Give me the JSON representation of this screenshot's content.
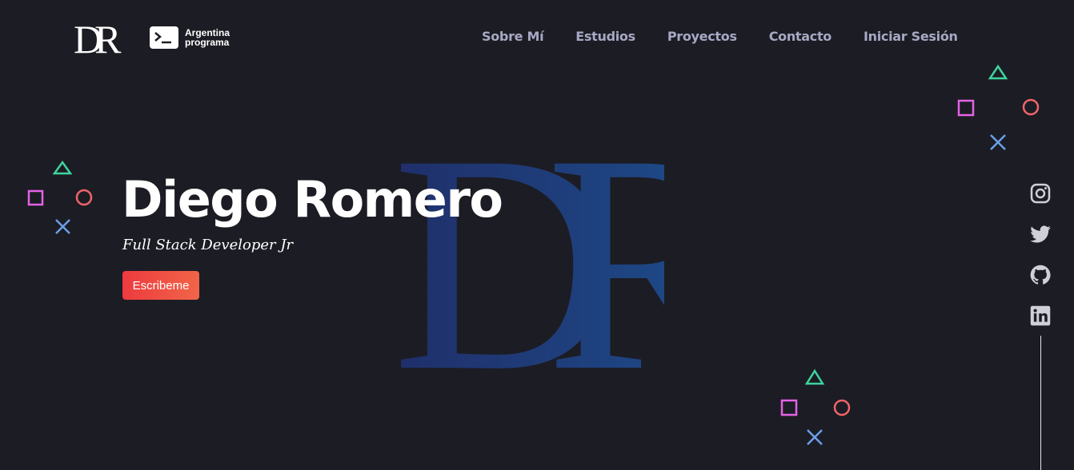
{
  "header": {
    "logo_text": "DR",
    "partner": {
      "line1": "Argentina",
      "line2": "programa",
      "icon": "terminal-icon"
    }
  },
  "nav": {
    "items": [
      {
        "label": "Sobre Mí"
      },
      {
        "label": "Estudios"
      },
      {
        "label": "Proyectos"
      },
      {
        "label": "Contacto"
      },
      {
        "label": "Iniciar Sesión"
      }
    ]
  },
  "hero": {
    "name": "Diego Romero",
    "role": "Full Stack Developer Jr",
    "cta": "Escribeme",
    "watermark": "DR"
  },
  "social": [
    "instagram-icon",
    "twitter-icon",
    "github-icon",
    "linkedin-icon"
  ],
  "colors": {
    "background": "#1c1c24",
    "nav_text": "#a7a8c4",
    "cta_start": "#ee3a3f",
    "cta_end": "#f06548",
    "shape_triangle": "#3fd39c",
    "shape_square": "#e462e6",
    "shape_circle": "#f0656a",
    "shape_cross": "#6aa0e8",
    "watermark_start": "#1f2f6a",
    "watermark_end": "#1e4f8e"
  }
}
